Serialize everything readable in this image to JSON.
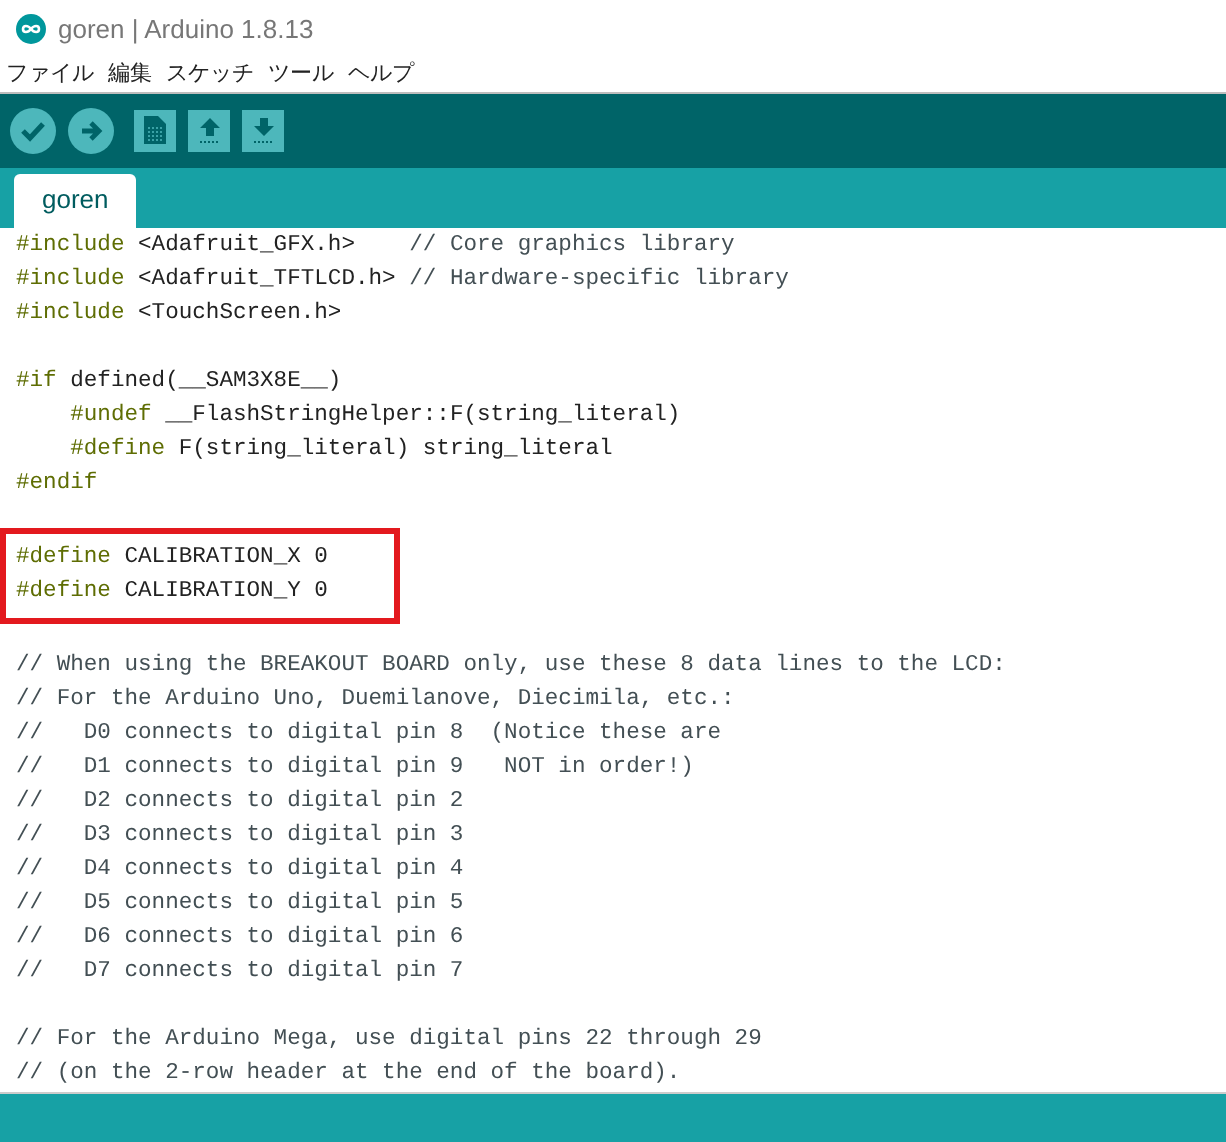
{
  "window": {
    "title": "goren | Arduino 1.8.13"
  },
  "menu": [
    "ファイル",
    "編集",
    "スケッチ",
    "ツール",
    "ヘルプ"
  ],
  "toolbar": [
    {
      "kind": "verify"
    },
    {
      "kind": "upload"
    },
    {
      "kind": "new"
    },
    {
      "kind": "open"
    },
    {
      "kind": "save"
    }
  ],
  "tabs": [
    {
      "label": "goren",
      "selected": true
    }
  ],
  "code": [
    {
      "kind": "code",
      "highlighted": false,
      "segments": [
        {
          "kind": "directive",
          "text": "#include"
        },
        {
          "kind": "plain",
          "text": " <Adafruit_GFX.h>    "
        },
        {
          "kind": "comment",
          "text": "// Core graphics library"
        }
      ]
    },
    {
      "kind": "code",
      "highlighted": false,
      "segments": [
        {
          "kind": "directive",
          "text": "#include"
        },
        {
          "kind": "plain",
          "text": " <Adafruit_TFTLCD.h> "
        },
        {
          "kind": "comment",
          "text": "// Hardware-specific library"
        }
      ]
    },
    {
      "kind": "code",
      "highlighted": false,
      "segments": [
        {
          "kind": "directive",
          "text": "#include"
        },
        {
          "kind": "plain",
          "text": " <TouchScreen.h>"
        }
      ]
    },
    {
      "kind": "blank"
    },
    {
      "kind": "code",
      "highlighted": false,
      "segments": [
        {
          "kind": "directive",
          "text": "#if"
        },
        {
          "kind": "plain",
          "text": " defined(__SAM3X8E__)"
        }
      ]
    },
    {
      "kind": "code",
      "highlighted": false,
      "segments": [
        {
          "kind": "directive",
          "text": "    #undef"
        },
        {
          "kind": "plain",
          "text": " __FlashStringHelper::F(string_literal)"
        }
      ]
    },
    {
      "kind": "code",
      "highlighted": false,
      "segments": [
        {
          "kind": "directive",
          "text": "    #define"
        },
        {
          "kind": "plain",
          "text": " F(string_literal) string_literal"
        }
      ]
    },
    {
      "kind": "code",
      "highlighted": false,
      "segments": [
        {
          "kind": "directive",
          "text": "#endif"
        }
      ]
    },
    {
      "kind": "blank"
    },
    {
      "kind": "code",
      "highlighted": true,
      "segments": [
        {
          "kind": "directive",
          "text": "#define"
        },
        {
          "kind": "plain",
          "text": " CALIBRATION_X 0"
        }
      ]
    },
    {
      "kind": "code",
      "highlighted": true,
      "segments": [
        {
          "kind": "directive",
          "text": "#define"
        },
        {
          "kind": "plain",
          "text": " CALIBRATION_Y 0"
        }
      ]
    },
    {
      "kind": "blank"
    },
    {
      "kind": "code",
      "highlighted": false,
      "segments": [
        {
          "kind": "comment",
          "text": "// When using the BREAKOUT BOARD only, use these 8 data lines to the LCD:"
        }
      ]
    },
    {
      "kind": "code",
      "highlighted": false,
      "segments": [
        {
          "kind": "comment",
          "text": "// For the Arduino Uno, Duemilanove, Diecimila, etc.:"
        }
      ]
    },
    {
      "kind": "code",
      "highlighted": false,
      "segments": [
        {
          "kind": "comment",
          "text": "//   D0 connects to digital pin 8  (Notice these are"
        }
      ]
    },
    {
      "kind": "code",
      "highlighted": false,
      "segments": [
        {
          "kind": "comment",
          "text": "//   D1 connects to digital pin 9   NOT in order!)"
        }
      ]
    },
    {
      "kind": "code",
      "highlighted": false,
      "segments": [
        {
          "kind": "comment",
          "text": "//   D2 connects to digital pin 2"
        }
      ]
    },
    {
      "kind": "code",
      "highlighted": false,
      "segments": [
        {
          "kind": "comment",
          "text": "//   D3 connects to digital pin 3"
        }
      ]
    },
    {
      "kind": "code",
      "highlighted": false,
      "segments": [
        {
          "kind": "comment",
          "text": "//   D4 connects to digital pin 4"
        }
      ]
    },
    {
      "kind": "code",
      "highlighted": false,
      "segments": [
        {
          "kind": "comment",
          "text": "//   D5 connects to digital pin 5"
        }
      ]
    },
    {
      "kind": "code",
      "highlighted": false,
      "segments": [
        {
          "kind": "comment",
          "text": "//   D6 connects to digital pin 6"
        }
      ]
    },
    {
      "kind": "code",
      "highlighted": false,
      "segments": [
        {
          "kind": "comment",
          "text": "//   D7 connects to digital pin 7"
        }
      ]
    },
    {
      "kind": "blank"
    },
    {
      "kind": "code",
      "highlighted": false,
      "segments": [
        {
          "kind": "comment",
          "text": "// For the Arduino Mega, use digital pins 22 through 29"
        }
      ]
    },
    {
      "kind": "code",
      "highlighted": false,
      "segments": [
        {
          "kind": "comment",
          "text": "// (on the 2-row header at the end of the board)."
        }
      ]
    }
  ]
}
